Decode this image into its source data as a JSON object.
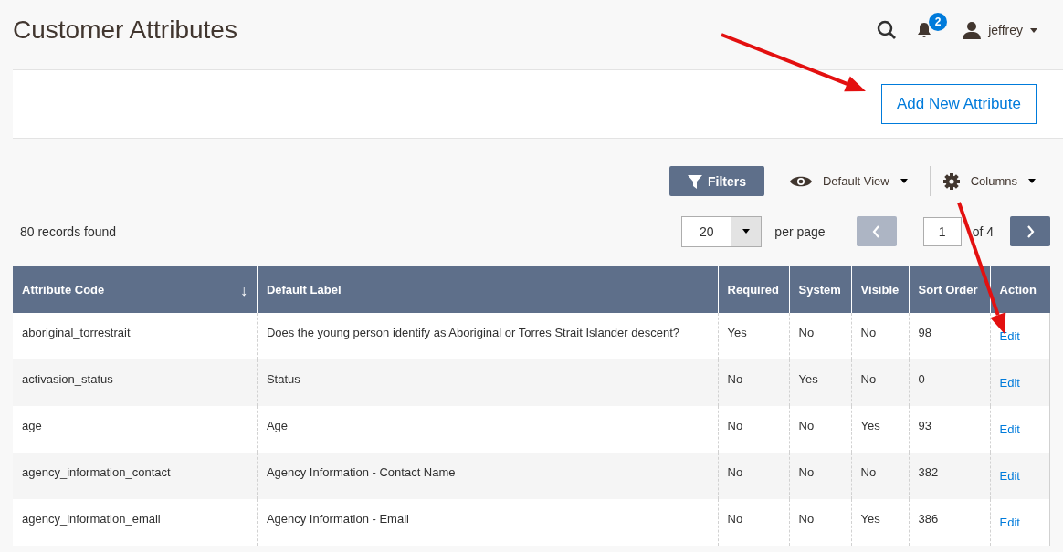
{
  "page_title": "Customer Attributes",
  "header": {
    "notifications": "2",
    "user": "jeffrey"
  },
  "action_bar": {
    "button": "Add New Attribute"
  },
  "toolbar": {
    "filters": "Filters",
    "view": "Default View",
    "columns": "Columns"
  },
  "records": "80 records found",
  "pager": {
    "per_page_value": "20",
    "per_page_label": "per page",
    "page": "1",
    "of_pages": "of 4",
    "previous": {
      "disabled": true
    },
    "next": {
      "disabled": false
    }
  },
  "table": {
    "columns": [
      {
        "label": "Attribute Code",
        "sort_indicator": "↓"
      },
      {
        "label": "Default Label"
      },
      {
        "label": "Required"
      },
      {
        "label": "System"
      },
      {
        "label": "Visible"
      },
      {
        "label": "Sort Order"
      },
      {
        "label": "Action"
      }
    ],
    "rows": [
      {
        "cells": [
          "aboriginal_torrestrait",
          "Does the young person identify as Aboriginal or Torres Strait Islander descent?",
          "Yes",
          "No",
          "No",
          "98"
        ],
        "action": "Edit"
      },
      {
        "cells": [
          "activasion_status",
          "Status",
          "No",
          "Yes",
          "No",
          "0"
        ],
        "action": "Edit"
      },
      {
        "cells": [
          "age",
          "Age",
          "No",
          "No",
          "Yes",
          "93"
        ],
        "action": "Edit"
      },
      {
        "cells": [
          "agency_information_contact",
          "Agency Information - Contact Name",
          "No",
          "No",
          "No",
          "382"
        ],
        "action": "Edit"
      },
      {
        "cells": [
          "agency_information_email",
          "Agency Information - Email",
          "No",
          "No",
          "Yes",
          "386"
        ],
        "action": "Edit"
      }
    ]
  },
  "annotations": [
    {
      "kind": "arrow"
    },
    {
      "kind": "arrow"
    }
  ]
}
